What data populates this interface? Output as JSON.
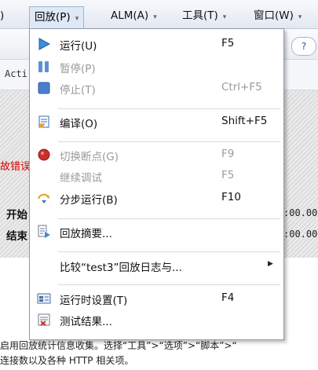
{
  "menubar": {
    "left_fragment": ")",
    "items": [
      {
        "label": "回放(P)"
      },
      {
        "label": "ALM(A)"
      },
      {
        "label": "工具(T)"
      },
      {
        "label": "窗口(W)"
      }
    ],
    "arrow": "▾"
  },
  "background": {
    "help_label": "?",
    "tab_text": "Acti",
    "error_fragment": "故错误",
    "start_label": "开始",
    "end_label": "结束",
    "start_time": ":00.00",
    "end_time": ":00.00",
    "bottom_line1": "启用回放统计信息收集。选择“工具”>“选项”>“脚本”>“",
    "bottom_line2": "连接数以及各种 HTTP 相关项。"
  },
  "menu": {
    "items": [
      {
        "label": "运行(U)",
        "shortcut": "F5",
        "icon": "play-icon",
        "disabled": false
      },
      {
        "label": "暂停(P)",
        "shortcut": "",
        "icon": "pause-icon",
        "disabled": true
      },
      {
        "label": "停止(T)",
        "shortcut": "Ctrl+F5",
        "icon": "stop-icon",
        "disabled": true
      },
      {
        "label": "编译(O)",
        "shortcut": "Shift+F5",
        "icon": "compile-icon",
        "disabled": false
      },
      {
        "label": "切换断点(G)",
        "shortcut": "F9",
        "icon": "breakpoint-icon",
        "disabled": true
      },
      {
        "label": "继续调试",
        "shortcut": "F5",
        "icon": "",
        "disabled": true
      },
      {
        "label": "分步运行(B)",
        "shortcut": "F10",
        "icon": "step-icon",
        "disabled": false
      },
      {
        "label": "回放摘要...",
        "shortcut": "",
        "icon": "summary-icon",
        "disabled": false
      },
      {
        "label": "比较“test3”回放日志与...",
        "shortcut": "",
        "icon": "",
        "disabled": false,
        "submenu": "▶"
      },
      {
        "label": "运行时设置(T)",
        "shortcut": "F4",
        "icon": "runtime-settings-icon",
        "disabled": false
      },
      {
        "label": "测试结果...",
        "shortcut": "",
        "icon": "test-results-icon",
        "disabled": false
      }
    ]
  },
  "colors": {
    "accent_blue": "#3b73c8",
    "breakpoint_red": "#c8302c",
    "error_red": "#d40000"
  }
}
